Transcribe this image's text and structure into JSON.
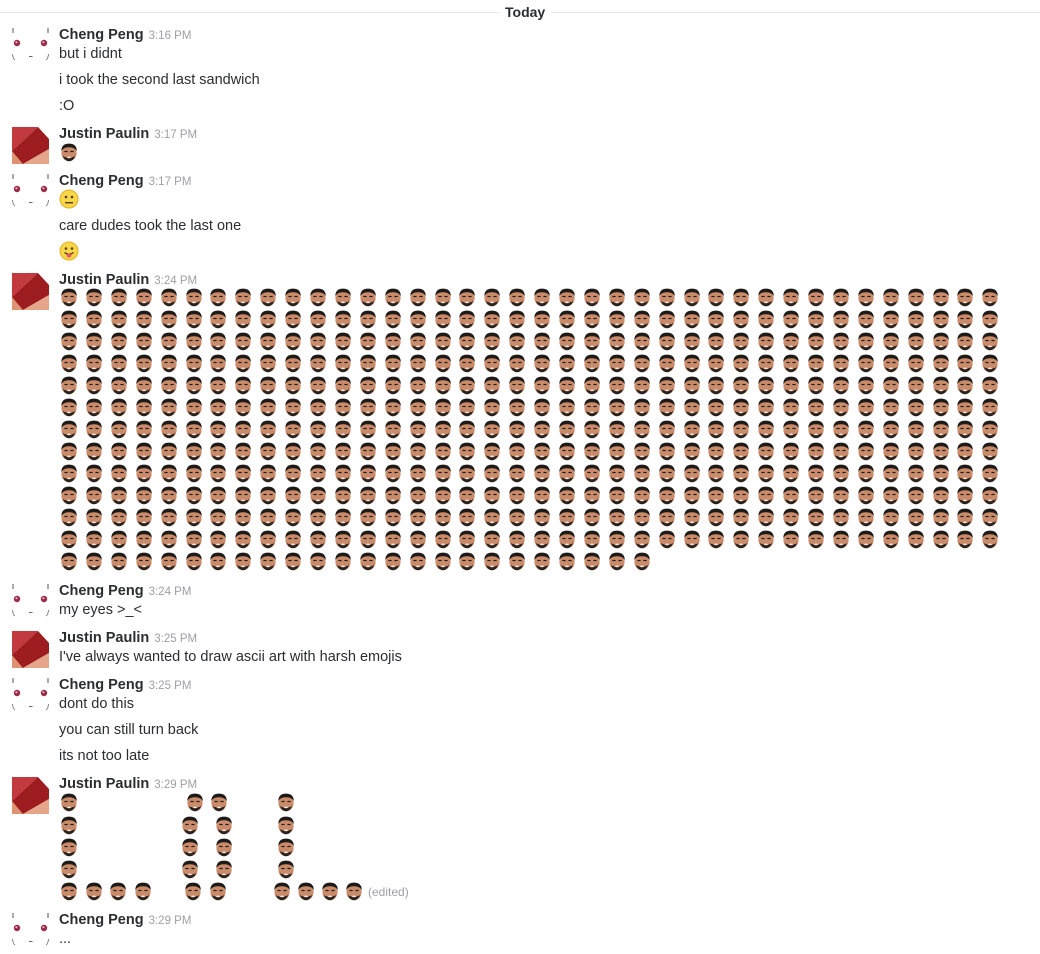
{
  "divider": {
    "label": "Today"
  },
  "users": {
    "cheng": {
      "name": "Cheng Peng",
      "avatar_icon": "cute-face-avatar-icon"
    },
    "justin": {
      "name": "Justin Paulin",
      "avatar_icon": "red-tri-avatar-icon"
    }
  },
  "messages": [
    {
      "author": "Cheng Peng",
      "time": "3:16 PM",
      "lines": [
        "but i didnt",
        "i took the second last sandwich",
        ":O"
      ]
    },
    {
      "author": "Justin Paulin",
      "time": "3:17 PM",
      "emoji": "face-emoji"
    },
    {
      "author": "Cheng Peng",
      "time": "3:17 PM",
      "lines": [
        "care dudes took the last one"
      ],
      "emojis": [
        "neutral-face-emoji",
        "tongue-face-emoji"
      ]
    },
    {
      "author": "Justin Paulin",
      "time": "3:24 PM",
      "emoji_wall": {
        "emoji": "face-emoji",
        "per_row": 38,
        "full_rows": 12,
        "last_row_count": 24
      }
    },
    {
      "author": "Cheng Peng",
      "time": "3:24 PM",
      "lines": [
        "my eyes >_<"
      ]
    },
    {
      "author": "Justin Paulin",
      "time": "3:25 PM",
      "lines": [
        "I've always wanted to draw ascii art with harsh emojis"
      ]
    },
    {
      "author": "Cheng Peng",
      "time": "3:25 PM",
      "lines": [
        "dont do this",
        "you can still turn back",
        "its not too late"
      ]
    },
    {
      "author": "Justin Paulin",
      "time": "3:29 PM",
      "emoji_art": "LOL",
      "edited_label": "(edited)"
    },
    {
      "author": "Cheng Peng",
      "time": "3:29 PM",
      "lines": [
        "..."
      ]
    }
  ],
  "colors": {
    "text": "#2c2d30",
    "muted": "#9e9ea6",
    "divider": "#e8e8e8"
  }
}
